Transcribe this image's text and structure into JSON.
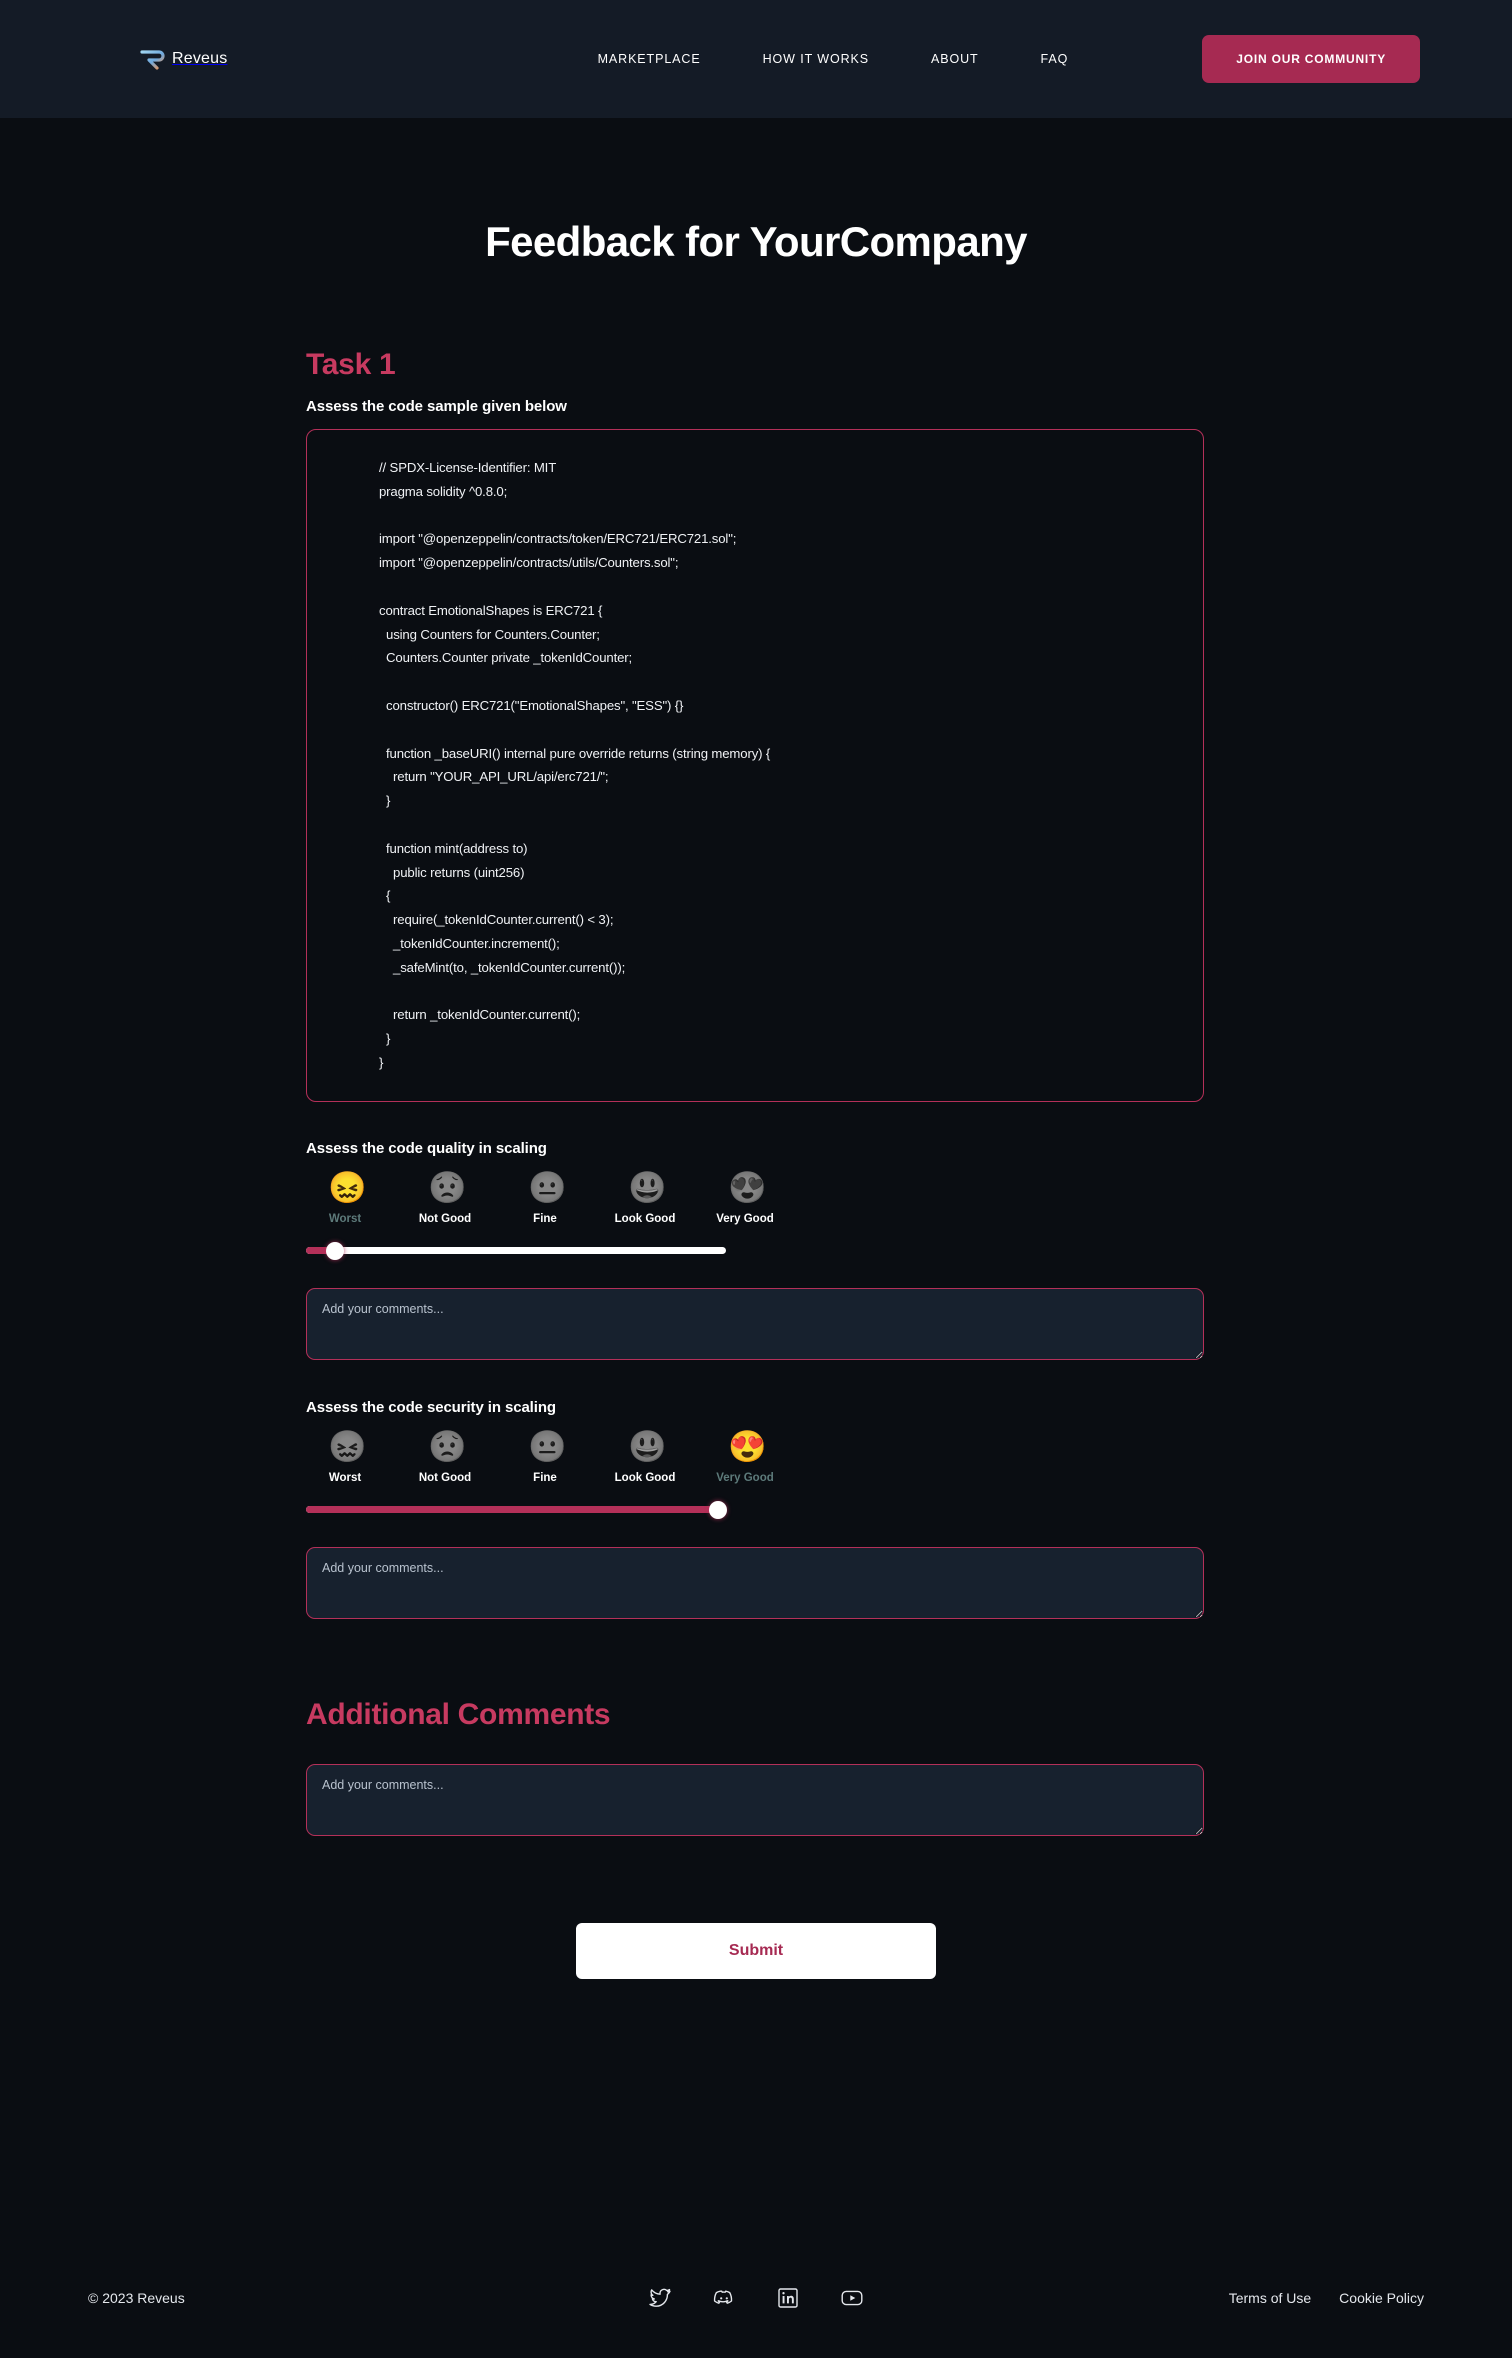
{
  "header": {
    "brand": "Reveus",
    "nav": [
      {
        "label": "MARKETPLACE"
      },
      {
        "label": "HOW IT WORKS"
      },
      {
        "label": "ABOUT"
      },
      {
        "label": "FAQ"
      }
    ],
    "cta_label": "JOIN OUR COMMUNITY"
  },
  "page": {
    "title": "Feedback for YourCompany"
  },
  "task": {
    "heading": "Task 1",
    "code_prompt_label": "Assess the code sample given below",
    "code_sample": "// SPDX-License-Identifier: MIT\npragma solidity ^0.8.0;\n\nimport \"@openzeppelin/contracts/token/ERC721/ERC721.sol\";\nimport \"@openzeppelin/contracts/utils/Counters.sol\";\n\ncontract EmotionalShapes is ERC721 {\n  using Counters for Counters.Counter;\n  Counters.Counter private _tokenIdCounter;\n\n  constructor() ERC721(\"EmotionalShapes\", \"ESS\") {}\n\n  function _baseURI() internal pure override returns (string memory) {\n    return \"YOUR_API_URL/api/erc721/\";\n  }\n\n  function mint(address to)\n    public returns (uint256)\n  {\n    require(_tokenIdCounter.current() < 3);\n    _tokenIdCounter.increment();\n    _safeMint(to, _tokenIdCounter.current());\n\n    return _tokenIdCounter.current();\n  }\n}"
  },
  "ratings": [
    {
      "label": "Assess the code quality in scaling",
      "selected_index": 0,
      "slider_percent": 7,
      "options": [
        {
          "label": "Worst",
          "emoji": "😖",
          "icon": "confounded-face-icon"
        },
        {
          "label": "Not\nGood",
          "emoji": "😟",
          "icon": "worried-face-icon"
        },
        {
          "label": "Fine",
          "emoji": "😐",
          "icon": "neutral-face-icon"
        },
        {
          "label": "Look\nGood",
          "emoji": "😃",
          "icon": "smiling-face-icon"
        },
        {
          "label": "Very\nGood",
          "emoji": "😍",
          "icon": "heart-eyes-face-icon"
        }
      ],
      "comment_value": "",
      "comment_placeholder": "Add your comments..."
    },
    {
      "label": "Assess the code security in scaling",
      "selected_index": 4,
      "slider_percent": 98,
      "options": [
        {
          "label": "Worst",
          "emoji": "😖",
          "icon": "confounded-face-icon"
        },
        {
          "label": "Not\nGood",
          "emoji": "😟",
          "icon": "worried-face-icon"
        },
        {
          "label": "Fine",
          "emoji": "😐",
          "icon": "neutral-face-icon"
        },
        {
          "label": "Look\nGood",
          "emoji": "😃",
          "icon": "smiling-face-icon"
        },
        {
          "label": "Very\nGood",
          "emoji": "😍",
          "icon": "heart-eyes-face-icon"
        }
      ],
      "comment_value": "",
      "comment_placeholder": "Add your comments..."
    }
  ],
  "additional": {
    "heading": "Additional Comments",
    "comment_value": "",
    "comment_placeholder": "Add your comments..."
  },
  "submit": {
    "label": "Submit"
  },
  "footer": {
    "copyright": "© 2023 Reveus",
    "social": [
      {
        "name": "twitter-icon"
      },
      {
        "name": "discord-icon"
      },
      {
        "name": "linkedin-icon"
      },
      {
        "name": "youtube-icon"
      }
    ],
    "links": [
      {
        "label": "Terms of Use"
      },
      {
        "label": "Cookie Policy"
      }
    ]
  },
  "colors": {
    "accent": "#b43059",
    "accent_heading": "#c73a60",
    "cta": "#a62a52",
    "header_bg": "#141b26",
    "page_bg": "#0a0d12",
    "input_bg": "#17212e",
    "selected_label": "#5d7a7a"
  }
}
